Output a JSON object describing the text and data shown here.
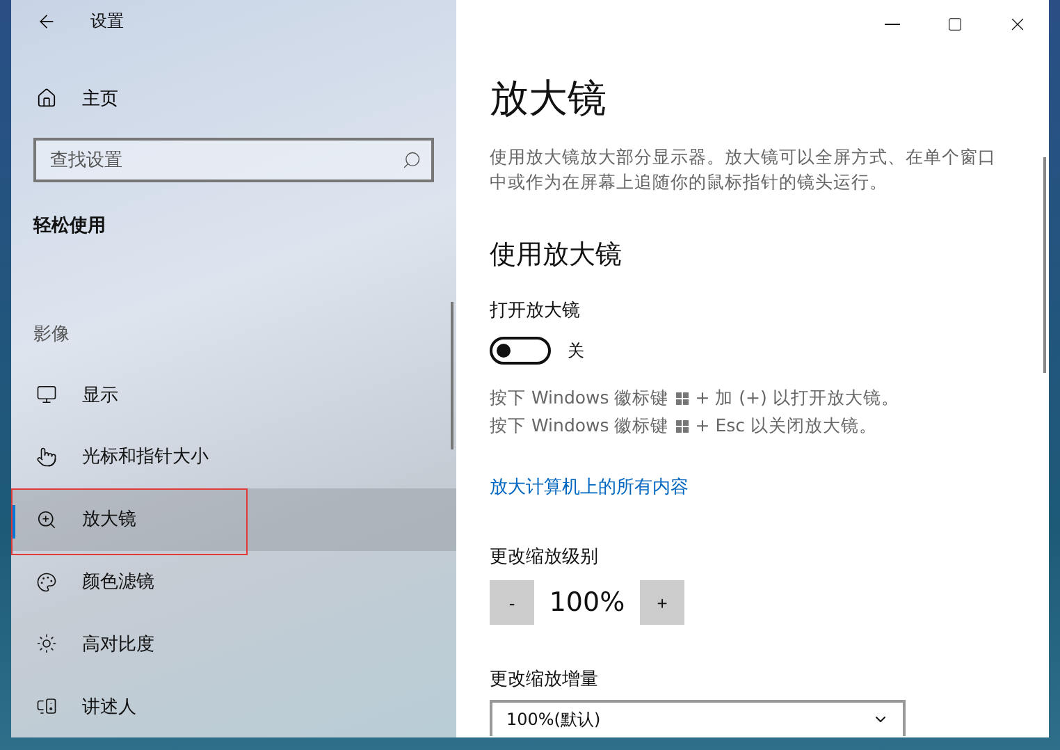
{
  "window": {
    "title": "设置"
  },
  "sidebar": {
    "home": "主页",
    "search": {
      "placeholder": "查找设置"
    },
    "section": "轻松使用",
    "group": "影像",
    "items": [
      {
        "label": "显示",
        "selected": false
      },
      {
        "label": "光标和指针大小",
        "selected": false
      },
      {
        "label": "放大镜",
        "selected": true
      },
      {
        "label": "颜色滤镜",
        "selected": false
      },
      {
        "label": "高对比度",
        "selected": false
      },
      {
        "label": "讲述人",
        "selected": false
      }
    ]
  },
  "page": {
    "title": "放大镜",
    "description": "使用放大镜放大部分显示器。放大镜可以全屏方式、在单个窗口中或作为在屏幕上追随你的鼠标指针的镜头运行。",
    "section": "使用放大镜",
    "toggle": {
      "label": "打开放大镜",
      "on": false,
      "state_text": "关"
    },
    "hints": [
      {
        "before": "按下 Windows 徽标键",
        "after": "+ 加 (+) 以打开放大镜。"
      },
      {
        "before": "按下 Windows 徽标键",
        "after": "+ Esc 以关闭放大镜。"
      }
    ],
    "link": "放大计算机上的所有内容",
    "zoom_level": {
      "label": "更改缩放级别",
      "minus": "-",
      "value": "100%",
      "plus": "+"
    },
    "zoom_increment": {
      "label": "更改缩放增量",
      "value": "100%(默认)"
    }
  }
}
